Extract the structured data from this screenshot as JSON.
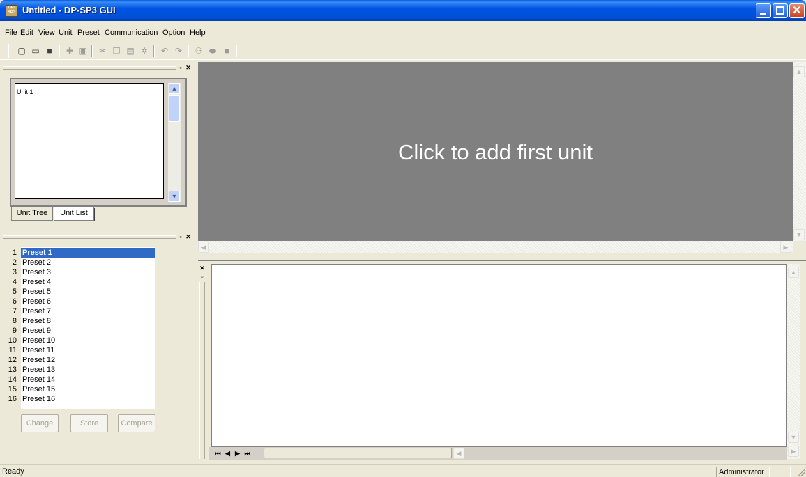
{
  "window": {
    "title": "Untitled - DP-SP3 GUI",
    "icon_label": "DP-SP3",
    "controls": [
      "minimize-icon",
      "maximize-icon",
      "close-icon"
    ]
  },
  "menu": [
    "File",
    "Edit",
    "View",
    "Unit",
    "Preset",
    "Communication",
    "Option",
    "Help"
  ],
  "toolbar": {
    "icons": [
      "new-file-icon",
      "open-folder-icon",
      "save-icon",
      "add-unit-icon",
      "print-preview-icon",
      "cut-icon",
      "copy-icon",
      "paste-icon",
      "settings-icon",
      "undo-icon",
      "redo-icon",
      "connect-icon",
      "link-icon",
      "stop-icon"
    ]
  },
  "unit_panel": {
    "items": [
      "Unit 1"
    ],
    "tabs": [
      "Unit Tree",
      "Unit List"
    ],
    "active_tab": "Unit Tree"
  },
  "preset_panel": {
    "presets": [
      {
        "num": "1",
        "name": "Preset 1"
      },
      {
        "num": "2",
        "name": "Preset 2"
      },
      {
        "num": "3",
        "name": "Preset 3"
      },
      {
        "num": "4",
        "name": "Preset 4"
      },
      {
        "num": "5",
        "name": "Preset 5"
      },
      {
        "num": "6",
        "name": "Preset 6"
      },
      {
        "num": "7",
        "name": "Preset 7"
      },
      {
        "num": "8",
        "name": "Preset 8"
      },
      {
        "num": "9",
        "name": "Preset 9"
      },
      {
        "num": "10",
        "name": "Preset 10"
      },
      {
        "num": "11",
        "name": "Preset 11"
      },
      {
        "num": "12",
        "name": "Preset 12"
      },
      {
        "num": "13",
        "name": "Preset 13"
      },
      {
        "num": "14",
        "name": "Preset 14"
      },
      {
        "num": "15",
        "name": "Preset 15"
      },
      {
        "num": "16",
        "name": "Preset 16"
      }
    ],
    "selected": "Preset 1",
    "buttons": {
      "change": "Change",
      "store": "Store",
      "compare": "Compare"
    }
  },
  "main_view": {
    "prompt": "Click to add first unit",
    "background": "#808080"
  },
  "status": {
    "text": "Ready",
    "user": "Administrator"
  },
  "colors": {
    "titlebar": "#0054e3",
    "selection": "#316ac5",
    "chrome": "#ece9d8"
  }
}
